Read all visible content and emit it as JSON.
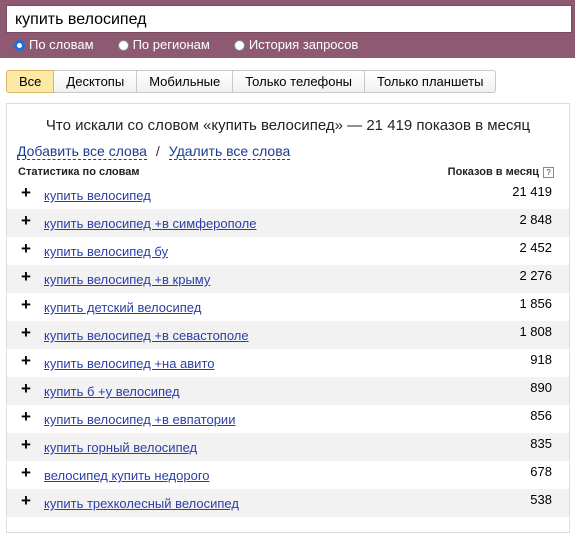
{
  "search": {
    "query": "купить велосипед"
  },
  "radios": [
    {
      "label": "По словам",
      "checked": true
    },
    {
      "label": "По регионам",
      "checked": false
    },
    {
      "label": "История запросов",
      "checked": false
    }
  ],
  "tabs": [
    {
      "label": "Все",
      "active": true
    },
    {
      "label": "Десктопы",
      "active": false
    },
    {
      "label": "Мобильные",
      "active": false
    },
    {
      "label": "Только телефоны",
      "active": false
    },
    {
      "label": "Только планшеты",
      "active": false
    }
  ],
  "panel": {
    "summary": "Что искали со словом «купить велосипед» — 21 419 показов в месяц",
    "add_all": "Добавить все слова",
    "separator": "/",
    "remove_all": "Удалить все слова",
    "col_phrase": "Статистика по словам",
    "col_count": "Показов в месяц",
    "help_glyph": "?"
  },
  "rows": [
    {
      "phrase": "купить велосипед",
      "count": "21 419"
    },
    {
      "phrase": "купить велосипед +в симферополе",
      "count": "2 848"
    },
    {
      "phrase": "купить велосипед бу",
      "count": "2 452"
    },
    {
      "phrase": "купить велосипед +в крыму",
      "count": "2 276"
    },
    {
      "phrase": "купить детский велосипед",
      "count": "1 856"
    },
    {
      "phrase": "купить велосипед +в севастополе",
      "count": "1 808"
    },
    {
      "phrase": "купить велосипед +на авито",
      "count": "918"
    },
    {
      "phrase": "купить б +у велосипед",
      "count": "890"
    },
    {
      "phrase": "купить велосипед +в евпатории",
      "count": "856"
    },
    {
      "phrase": "купить горный велосипед",
      "count": "835"
    },
    {
      "phrase": "велосипед купить недорого",
      "count": "678"
    },
    {
      "phrase": "купить трехколесный велосипед",
      "count": "538"
    }
  ],
  "colors": {
    "header": "#8d5a72",
    "active_tab": "#fde8a6",
    "link": "#2a3fa8"
  }
}
